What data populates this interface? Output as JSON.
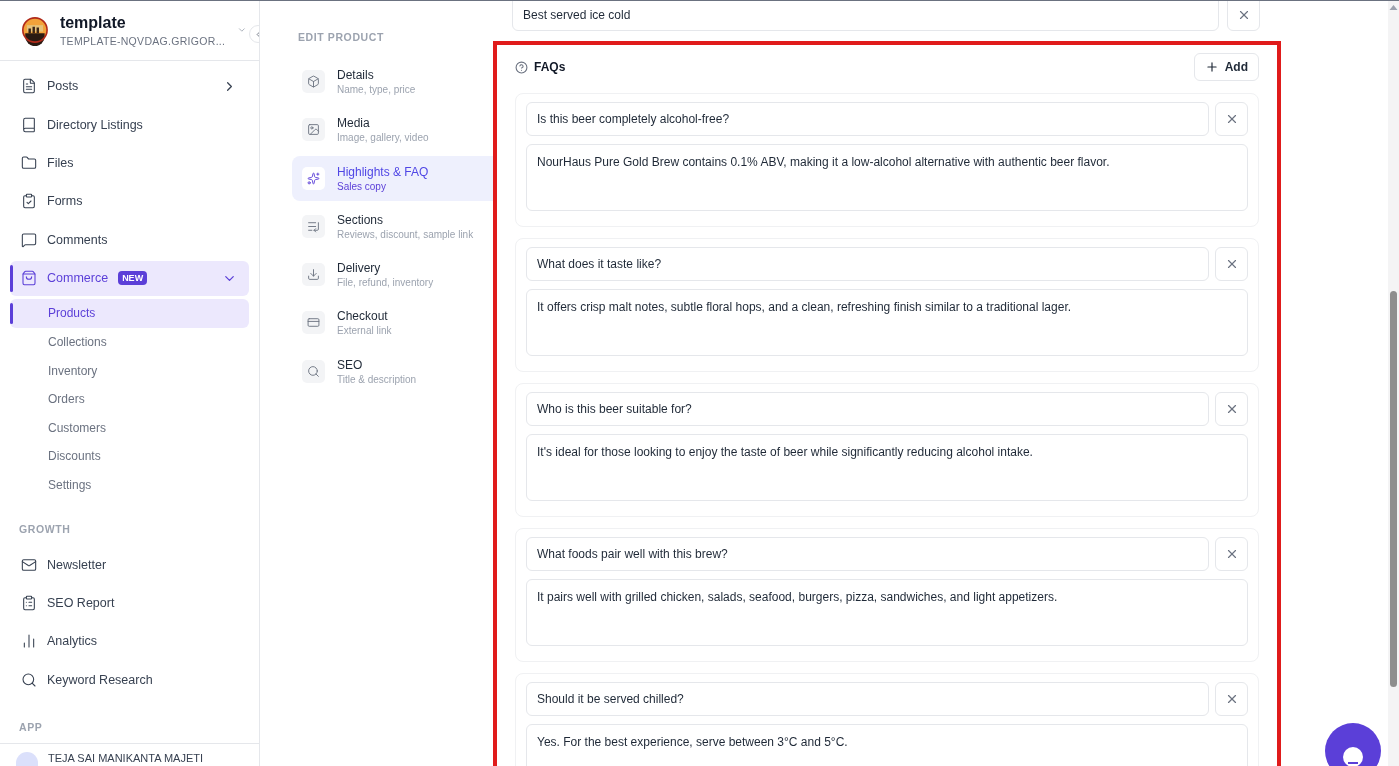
{
  "sidebar": {
    "workspace": {
      "name": "template",
      "domain": "TEMPLATE-NQVDAG.GRIGOR..."
    },
    "items": [
      {
        "kind": "group",
        "label": "Posts",
        "selected": false,
        "expanded": false
      },
      {
        "kind": "link",
        "label": "Directory Listings",
        "selected": false
      },
      {
        "kind": "link",
        "label": "Files",
        "selected": false
      },
      {
        "kind": "link",
        "label": "Forms",
        "selected": false
      },
      {
        "kind": "link",
        "label": "Comments",
        "selected": false
      },
      {
        "kind": "group",
        "label": "Commerce",
        "badge": "NEW",
        "selected": true,
        "expanded": true,
        "children": [
          {
            "label": "Products",
            "selected": true
          },
          {
            "label": "Collections",
            "selected": false
          },
          {
            "label": "Inventory",
            "selected": false
          },
          {
            "label": "Orders",
            "selected": false
          },
          {
            "label": "Customers",
            "selected": false
          },
          {
            "label": "Discounts",
            "selected": false
          },
          {
            "label": "Settings",
            "selected": false
          }
        ]
      }
    ],
    "growth": {
      "heading": "GROWTH",
      "items": [
        {
          "label": "Newsletter",
          "selected": false
        },
        {
          "label": "SEO Report",
          "selected": false
        },
        {
          "label": "Analytics",
          "selected": false
        },
        {
          "label": "Keyword Research",
          "selected": false
        }
      ]
    },
    "app_heading": "APP",
    "user": {
      "name": "TEJA SAI MANIKANTA MAJETI"
    }
  },
  "edit_nav": {
    "heading": "EDIT PRODUCT",
    "items": [
      {
        "title": "Details",
        "subtitle": "Name, type, price",
        "selected": false
      },
      {
        "title": "Media",
        "subtitle": "Image, gallery, video",
        "selected": false
      },
      {
        "title": "Highlights & FAQ",
        "subtitle": "Sales copy",
        "selected": true
      },
      {
        "title": "Sections",
        "subtitle": "Reviews, discount, sample link",
        "selected": false
      },
      {
        "title": "Delivery",
        "subtitle": "File, refund, inventory",
        "selected": false
      },
      {
        "title": "Checkout",
        "subtitle": "External link",
        "selected": false
      },
      {
        "title": "SEO",
        "subtitle": "Title & description",
        "selected": false
      }
    ]
  },
  "highlight_field": {
    "value": "Best served ice cold"
  },
  "faqs": {
    "title": "FAQs",
    "add_button": "Add",
    "items": [
      {
        "question": "Is this beer completely alcohol-free?",
        "answer": "NourHaus Pure Gold Brew contains 0.1% ABV, making it a low-alcohol alternative with authentic beer flavor."
      },
      {
        "question": "What does it taste like?",
        "answer": "It offers crisp malt notes, subtle floral hops, and a clean, refreshing finish similar to a traditional lager."
      },
      {
        "question": "Who is this beer suitable for?",
        "answer": "It's ideal for those looking to enjoy the taste of beer while significantly reducing alcohol intake."
      },
      {
        "question": "What foods pair well with this brew?",
        "answer": "It pairs well with grilled chicken, salads, seafood, burgers, pizza, sandwiches, and light appetizers."
      },
      {
        "question": "Should it be served chilled?",
        "answer": "Yes. For the best experience, serve between 3°C and 5°C."
      }
    ]
  }
}
